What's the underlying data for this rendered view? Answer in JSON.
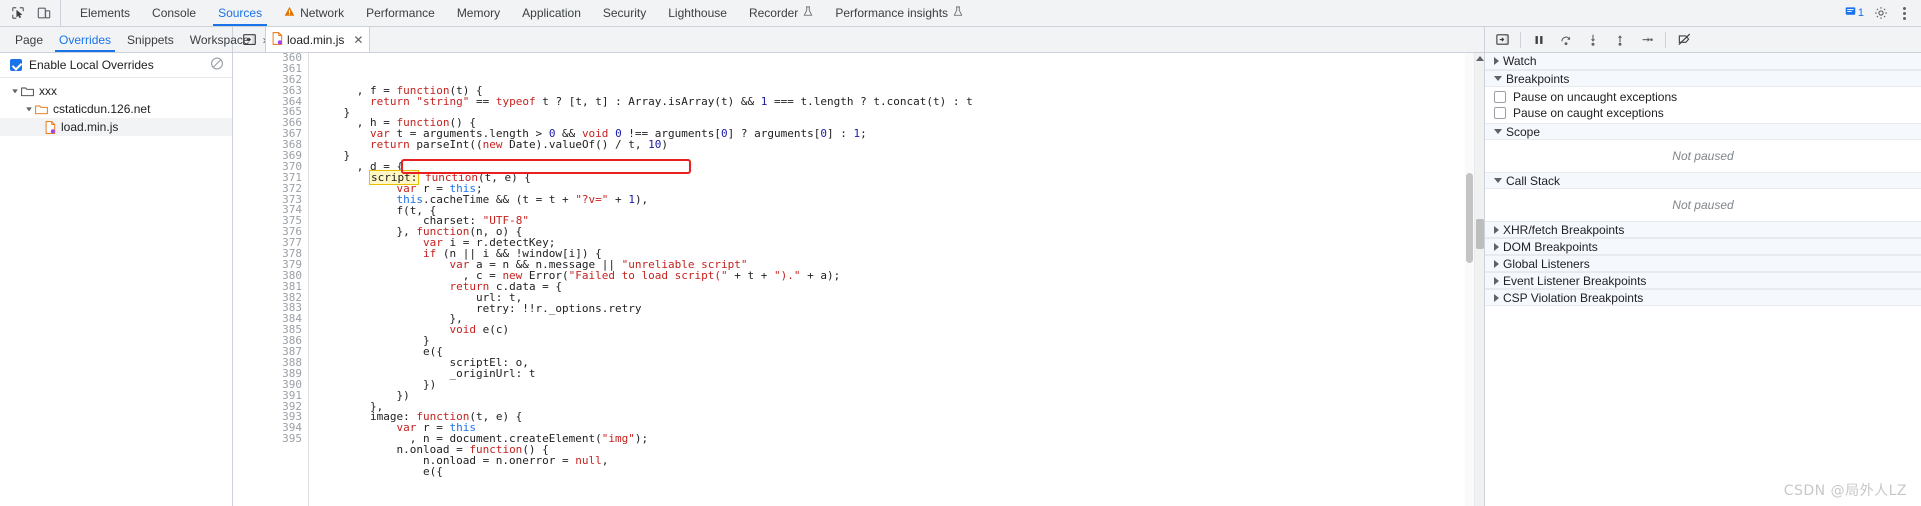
{
  "toolbar": {
    "inspect_icon": "inspect-cursor-icon",
    "device_icon": "device-toolbar-icon",
    "tabs": [
      {
        "label": "Elements",
        "selected": false,
        "warn": false
      },
      {
        "label": "Console",
        "selected": false,
        "warn": false
      },
      {
        "label": "Sources",
        "selected": true,
        "warn": false
      },
      {
        "label": "Network",
        "selected": false,
        "warn": true
      },
      {
        "label": "Performance",
        "selected": false,
        "warn": false
      },
      {
        "label": "Memory",
        "selected": false,
        "warn": false
      },
      {
        "label": "Application",
        "selected": false,
        "warn": false
      },
      {
        "label": "Security",
        "selected": false,
        "warn": false
      },
      {
        "label": "Lighthouse",
        "selected": false,
        "warn": false
      },
      {
        "label": "Recorder",
        "selected": false,
        "warn": false,
        "flask": true
      },
      {
        "label": "Performance insights",
        "selected": false,
        "warn": false,
        "flask": true
      }
    ],
    "issues_count": "1",
    "settings_icon": "gear-icon",
    "more_icon": "more-vertical-icon",
    "accent_color": "#1a73e8",
    "warn_color": "#e37400"
  },
  "navigator_tabs": {
    "items": [
      {
        "label": "Page",
        "selected": false
      },
      {
        "label": "Overrides",
        "selected": true
      },
      {
        "label": "Snippets",
        "selected": false
      },
      {
        "label": "Workspace",
        "selected": false
      }
    ],
    "more_label": "»",
    "kebab_icon": "more-vertical-icon"
  },
  "navigator": {
    "enable_overrides_label": "Enable Local Overrides",
    "enable_overrides_checked": true,
    "clear_icon": "clear-overrides-icon",
    "tree": [
      {
        "label": "xxx",
        "depth": 0,
        "type": "folder",
        "expanded": true,
        "selected": false
      },
      {
        "label": "cstaticdun.126.net",
        "depth": 1,
        "type": "folder",
        "expanded": true,
        "selected": false
      },
      {
        "label": "load.min.js",
        "depth": 2,
        "type": "file-js-override",
        "expanded": false,
        "selected": true
      }
    ]
  },
  "editor_tabs": {
    "panel_toggle_icon": "show-navigator-icon",
    "open_file": "load.min.js",
    "file_icon": "js-override-file-icon",
    "close_icon": "close-icon"
  },
  "debug_toolbar": {
    "buttons": [
      {
        "name": "pause-resume-script-execution",
        "icon": "pause-icon"
      },
      {
        "name": "step-over-next-function-call",
        "icon": "step-over-icon"
      },
      {
        "name": "step-into-next-function-call",
        "icon": "step-into-icon"
      },
      {
        "name": "step-out-of-current-function",
        "icon": "step-out-icon"
      },
      {
        "name": "step",
        "icon": "step-icon"
      },
      {
        "name": "deactivate-breakpoints",
        "icon": "deactivate-breakpoints-icon"
      }
    ]
  },
  "editor": {
    "first_line_number": 360,
    "highlight_token": "script:",
    "red_annotation_line": 370,
    "lines": [
      {
        "n": 360,
        "segs": [
          {
            "t": "      , ",
            "c": "t-plain"
          },
          {
            "t": "f",
            "c": "t-plain"
          },
          {
            "t": " = ",
            "c": "t-plain"
          },
          {
            "t": "function",
            "c": "t-kw"
          },
          {
            "t": "(t) {",
            "c": "t-plain"
          }
        ]
      },
      {
        "n": 361,
        "segs": [
          {
            "t": "        ",
            "c": "t-plain"
          },
          {
            "t": "return",
            "c": "t-kw"
          },
          {
            "t": " ",
            "c": "t-plain"
          },
          {
            "t": "\"string\"",
            "c": "t-str"
          },
          {
            "t": " == ",
            "c": "t-plain"
          },
          {
            "t": "typeof",
            "c": "t-kw"
          },
          {
            "t": " t ? [t, t] : Array.isArray(t) && ",
            "c": "t-plain"
          },
          {
            "t": "1",
            "c": "t-num"
          },
          {
            "t": " === t.length ? t.concat(t) : t",
            "c": "t-plain"
          }
        ]
      },
      {
        "n": 362,
        "segs": [
          {
            "t": "    }",
            "c": "t-plain"
          }
        ]
      },
      {
        "n": 363,
        "segs": [
          {
            "t": "      , ",
            "c": "t-plain"
          },
          {
            "t": "h",
            "c": "t-plain"
          },
          {
            "t": " = ",
            "c": "t-plain"
          },
          {
            "t": "function",
            "c": "t-kw"
          },
          {
            "t": "() {",
            "c": "t-plain"
          }
        ]
      },
      {
        "n": 364,
        "segs": [
          {
            "t": "        ",
            "c": "t-plain"
          },
          {
            "t": "var",
            "c": "t-kw"
          },
          {
            "t": " t = arguments.length > ",
            "c": "t-plain"
          },
          {
            "t": "0",
            "c": "t-num"
          },
          {
            "t": " && ",
            "c": "t-plain"
          },
          {
            "t": "void",
            "c": "t-kw"
          },
          {
            "t": " ",
            "c": "t-plain"
          },
          {
            "t": "0",
            "c": "t-num"
          },
          {
            "t": " !== arguments[",
            "c": "t-plain"
          },
          {
            "t": "0",
            "c": "t-num"
          },
          {
            "t": "] ? arguments[",
            "c": "t-plain"
          },
          {
            "t": "0",
            "c": "t-num"
          },
          {
            "t": "] : ",
            "c": "t-plain"
          },
          {
            "t": "1",
            "c": "t-num"
          },
          {
            "t": ";",
            "c": "t-plain"
          }
        ]
      },
      {
        "n": 365,
        "segs": [
          {
            "t": "        ",
            "c": "t-plain"
          },
          {
            "t": "return",
            "c": "t-kw"
          },
          {
            "t": " parseInt((",
            "c": "t-plain"
          },
          {
            "t": "new",
            "c": "t-kw"
          },
          {
            "t": " Date).valueOf() / t, ",
            "c": "t-plain"
          },
          {
            "t": "10",
            "c": "t-num"
          },
          {
            "t": ")",
            "c": "t-plain"
          }
        ]
      },
      {
        "n": 366,
        "segs": [
          {
            "t": "    }",
            "c": "t-plain"
          }
        ]
      },
      {
        "n": 367,
        "segs": [
          {
            "t": "      , ",
            "c": "t-plain"
          },
          {
            "t": "d",
            "c": "t-plain"
          },
          {
            "t": " = {",
            "c": "t-plain"
          }
        ]
      },
      {
        "n": 368,
        "segs": [
          {
            "t": "        ",
            "c": "t-plain"
          },
          {
            "t": "script:",
            "c": "t-plain",
            "hl": true
          },
          {
            "t": " ",
            "c": "t-plain"
          },
          {
            "t": "function",
            "c": "t-kw"
          },
          {
            "t": "(t, e) {",
            "c": "t-plain"
          }
        ]
      },
      {
        "n": 369,
        "segs": [
          {
            "t": "            ",
            "c": "t-plain"
          },
          {
            "t": "var",
            "c": "t-kw"
          },
          {
            "t": " r = ",
            "c": "t-plain"
          },
          {
            "t": "this",
            "c": "t-this"
          },
          {
            "t": ";",
            "c": "t-plain"
          }
        ]
      },
      {
        "n": 370,
        "segs": [
          {
            "t": "            ",
            "c": "t-plain"
          },
          {
            "t": "this",
            "c": "t-this"
          },
          {
            "t": ".cacheTime && (t = t + ",
            "c": "t-plain"
          },
          {
            "t": "\"?v=\"",
            "c": "t-str"
          },
          {
            "t": " + ",
            "c": "t-plain"
          },
          {
            "t": "1",
            "c": "t-num"
          },
          {
            "t": "),",
            "c": "t-plain"
          }
        ]
      },
      {
        "n": 371,
        "segs": [
          {
            "t": "            f(t, {",
            "c": "t-plain"
          }
        ]
      },
      {
        "n": 372,
        "segs": [
          {
            "t": "                charset: ",
            "c": "t-plain"
          },
          {
            "t": "\"UTF-8\"",
            "c": "t-str"
          }
        ]
      },
      {
        "n": 373,
        "segs": [
          {
            "t": "            }, ",
            "c": "t-plain"
          },
          {
            "t": "function",
            "c": "t-kw"
          },
          {
            "t": "(n, o) {",
            "c": "t-plain"
          }
        ]
      },
      {
        "n": 374,
        "segs": [
          {
            "t": "                ",
            "c": "t-plain"
          },
          {
            "t": "var",
            "c": "t-kw"
          },
          {
            "t": " i = r.detectKey;",
            "c": "t-plain"
          }
        ]
      },
      {
        "n": 375,
        "segs": [
          {
            "t": "                ",
            "c": "t-plain"
          },
          {
            "t": "if",
            "c": "t-kw"
          },
          {
            "t": " (n || i && !window[i]) {",
            "c": "t-plain"
          }
        ]
      },
      {
        "n": 376,
        "segs": [
          {
            "t": "                    ",
            "c": "t-plain"
          },
          {
            "t": "var",
            "c": "t-kw"
          },
          {
            "t": " a = n && n.message || ",
            "c": "t-plain"
          },
          {
            "t": "\"unreliable script\"",
            "c": "t-str"
          }
        ]
      },
      {
        "n": 377,
        "segs": [
          {
            "t": "                      , c = ",
            "c": "t-plain"
          },
          {
            "t": "new",
            "c": "t-kw"
          },
          {
            "t": " Error(",
            "c": "t-plain"
          },
          {
            "t": "\"Failed to load script(\"",
            "c": "t-str"
          },
          {
            "t": " + t + ",
            "c": "t-plain"
          },
          {
            "t": "\").\"",
            "c": "t-str"
          },
          {
            "t": " + a);",
            "c": "t-plain"
          }
        ]
      },
      {
        "n": 378,
        "segs": [
          {
            "t": "                    ",
            "c": "t-plain"
          },
          {
            "t": "return",
            "c": "t-kw"
          },
          {
            "t": " c.data = {",
            "c": "t-plain"
          }
        ]
      },
      {
        "n": 379,
        "segs": [
          {
            "t": "                        url: t,",
            "c": "t-plain"
          }
        ]
      },
      {
        "n": 380,
        "segs": [
          {
            "t": "                        retry: !!r._options.retry",
            "c": "t-plain"
          }
        ]
      },
      {
        "n": 381,
        "segs": [
          {
            "t": "                    },",
            "c": "t-plain"
          }
        ]
      },
      {
        "n": 382,
        "segs": [
          {
            "t": "                    ",
            "c": "t-plain"
          },
          {
            "t": "void",
            "c": "t-kw"
          },
          {
            "t": " e(c)",
            "c": "t-plain"
          }
        ]
      },
      {
        "n": 383,
        "segs": [
          {
            "t": "                }",
            "c": "t-plain"
          }
        ]
      },
      {
        "n": 384,
        "segs": [
          {
            "t": "                e({",
            "c": "t-plain"
          }
        ]
      },
      {
        "n": 385,
        "segs": [
          {
            "t": "                    scriptEl: o,",
            "c": "t-plain"
          }
        ]
      },
      {
        "n": 386,
        "segs": [
          {
            "t": "                    _originUrl: t",
            "c": "t-plain"
          }
        ]
      },
      {
        "n": 387,
        "segs": [
          {
            "t": "                })",
            "c": "t-plain"
          }
        ]
      },
      {
        "n": 388,
        "segs": [
          {
            "t": "            })",
            "c": "t-plain"
          }
        ]
      },
      {
        "n": 389,
        "segs": [
          {
            "t": "        },",
            "c": "t-plain"
          }
        ]
      },
      {
        "n": 390,
        "segs": [
          {
            "t": "        image: ",
            "c": "t-plain"
          },
          {
            "t": "function",
            "c": "t-kw"
          },
          {
            "t": "(t, e) {",
            "c": "t-plain"
          }
        ]
      },
      {
        "n": 391,
        "segs": [
          {
            "t": "            ",
            "c": "t-plain"
          },
          {
            "t": "var",
            "c": "t-kw"
          },
          {
            "t": " r = ",
            "c": "t-plain"
          },
          {
            "t": "this",
            "c": "t-this"
          }
        ]
      },
      {
        "n": 392,
        "segs": [
          {
            "t": "              , n = document.createElement(",
            "c": "t-plain"
          },
          {
            "t": "\"img\"",
            "c": "t-str"
          },
          {
            "t": ");",
            "c": "t-plain"
          }
        ]
      },
      {
        "n": 393,
        "segs": [
          {
            "t": "            n.onload = ",
            "c": "t-plain"
          },
          {
            "t": "function",
            "c": "t-kw"
          },
          {
            "t": "() {",
            "c": "t-plain"
          }
        ]
      },
      {
        "n": 394,
        "segs": [
          {
            "t": "                n.onload = n.onerror = ",
            "c": "t-plain"
          },
          {
            "t": "null",
            "c": "t-kw"
          },
          {
            "t": ",",
            "c": "t-plain"
          }
        ]
      },
      {
        "n": 395,
        "segs": [
          {
            "t": "                e({",
            "c": "t-plain"
          }
        ]
      }
    ]
  },
  "debugger_sidebar": {
    "sections": [
      {
        "label": "Watch",
        "expanded": false,
        "body": null
      },
      {
        "label": "Breakpoints",
        "expanded": true,
        "body": "breakpoint-options"
      },
      {
        "label": "Scope",
        "expanded": true,
        "body": "not-paused"
      },
      {
        "label": "Call Stack",
        "expanded": true,
        "body": "not-paused"
      },
      {
        "label": "XHR/fetch Breakpoints",
        "expanded": false,
        "body": null
      },
      {
        "label": "DOM Breakpoints",
        "expanded": false,
        "body": null
      },
      {
        "label": "Global Listeners",
        "expanded": false,
        "body": null
      },
      {
        "label": "Event Listener Breakpoints",
        "expanded": false,
        "body": null
      },
      {
        "label": "CSP Violation Breakpoints",
        "expanded": false,
        "body": null
      }
    ],
    "breakpoint_options": [
      {
        "label": "Pause on uncaught exceptions",
        "checked": false
      },
      {
        "label": "Pause on caught exceptions",
        "checked": false
      }
    ],
    "not_paused_text": "Not paused"
  },
  "watermark": {
    "text": "CSDN @局外人LZ"
  }
}
